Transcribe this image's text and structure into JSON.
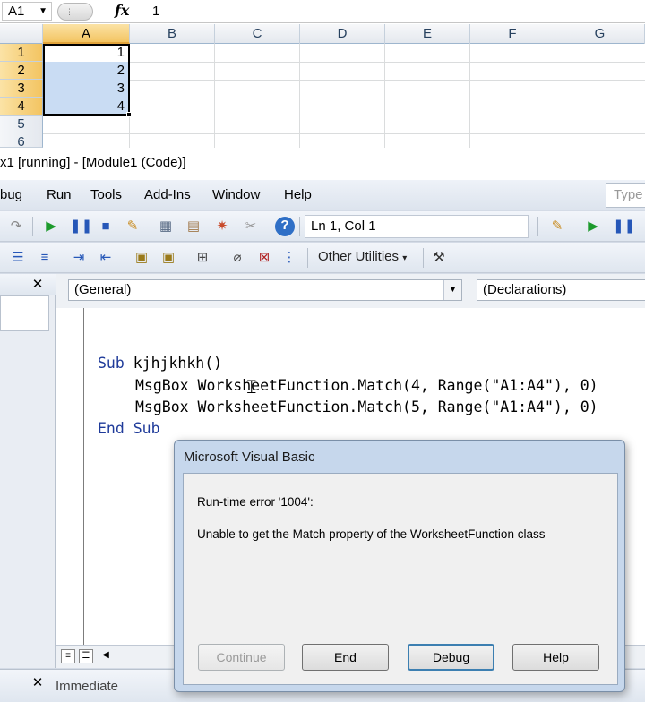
{
  "excel": {
    "name_box": "A1",
    "fx_label": "fx",
    "formula_value": "1",
    "columns": [
      "A",
      "B",
      "C",
      "D",
      "E",
      "F",
      "G"
    ],
    "rows": [
      "1",
      "2",
      "3",
      "4",
      "5",
      "6"
    ],
    "cells_a": [
      "1",
      "2",
      "3",
      "4"
    ]
  },
  "vbe": {
    "title": "x1 [running] - [Module1 (Code)]",
    "menu": [
      "bug",
      "Run",
      "Tools",
      "Add-Ins",
      "Window",
      "Help"
    ],
    "help_search_placeholder": "Type",
    "position": "Ln 1, Col 1",
    "other_utilities": "Other Utilities",
    "object_combo": "(General)",
    "procedure_combo": "(Declarations)",
    "code": {
      "line1_kw": "Sub",
      "line1_rest": " kjhjkhkh()",
      "line2": "MsgBox WorksheetFunction.Match(4, Range(\"A1:A4\"), 0)",
      "line3": "MsgBox WorksheetFunction.Match(5, Range(\"A1:A4\"), 0)",
      "line4": "End Sub"
    },
    "immediate_label": "Immediate"
  },
  "dialog": {
    "title": "Microsoft Visual Basic",
    "error_title": "Run-time error '1004':",
    "error_message": "Unable to get the Match property of the WorksheetFunction class",
    "buttons": {
      "continue": "Continue",
      "end": "End",
      "debug": "Debug",
      "help": "Help"
    }
  },
  "icons": [
    "dropdown-arrow-icon",
    "fx-icon",
    "run-icon",
    "pause-icon",
    "stop-icon",
    "design-mode-icon",
    "project-explorer-icon",
    "properties-icon",
    "object-browser-icon",
    "toolbox-icon",
    "help-icon",
    "close-icon",
    "indent-icon",
    "outdent-icon",
    "comment-icon",
    "uncomment-icon",
    "bookmark-icon",
    "toolbox-wrench-icon",
    "mouse-cursor-icon"
  ],
  "colors": {
    "keyword": "#1f3b9a",
    "selection": "#c9dcf3",
    "header_selected": "#f3c461",
    "dialog_frame": "#c6d7ec"
  }
}
